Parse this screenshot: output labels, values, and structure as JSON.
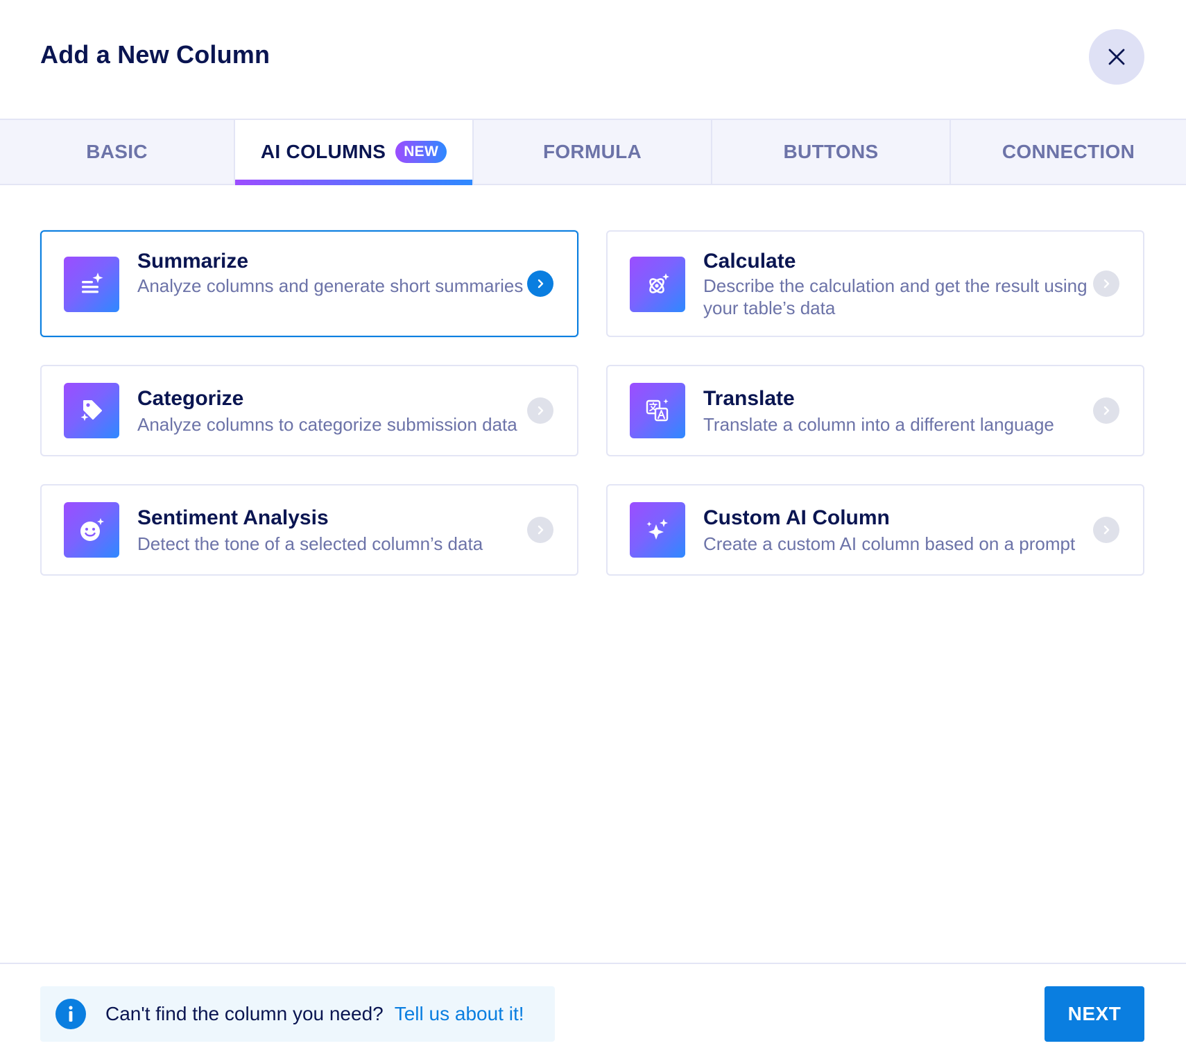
{
  "header": {
    "title": "Add a New Column",
    "close_icon": "close-icon"
  },
  "tabs": [
    {
      "label": "BASIC",
      "active": false
    },
    {
      "label": "AI COLUMNS",
      "active": true,
      "badge": "NEW"
    },
    {
      "label": "FORMULA",
      "active": false
    },
    {
      "label": "BUTTONS",
      "active": false
    },
    {
      "label": "CONNECTION",
      "active": false
    }
  ],
  "cards": [
    {
      "name": "Summarize",
      "description": "Analyze columns and generate short summaries",
      "icon": "summarize-icon",
      "selected": true
    },
    {
      "name": "Calculate",
      "description": "Describe the calculation and get the result using your table’s data",
      "icon": "calculate-icon",
      "selected": false
    },
    {
      "name": "Categorize",
      "description": "Analyze columns to categorize submission data",
      "icon": "categorize-icon",
      "selected": false
    },
    {
      "name": "Translate",
      "description": "Translate a column into a different language",
      "icon": "translate-icon",
      "selected": false
    },
    {
      "name": "Sentiment Analysis",
      "description": "Detect the tone of a selected column’s data",
      "icon": "sentiment-icon",
      "selected": false
    },
    {
      "name": "Custom AI Column",
      "description": "Create a custom AI column based on a prompt",
      "icon": "sparkles-icon",
      "selected": false
    }
  ],
  "footer": {
    "info_text": "Can't find the column you need?",
    "info_link": "Tell us about it!",
    "next_label": "NEXT"
  },
  "colors": {
    "primary": "#0a7ee0",
    "gradient_start": "#9c4dff",
    "gradient_end": "#2e89ff",
    "navy": "#0a1551",
    "muted": "#6c73a8"
  }
}
